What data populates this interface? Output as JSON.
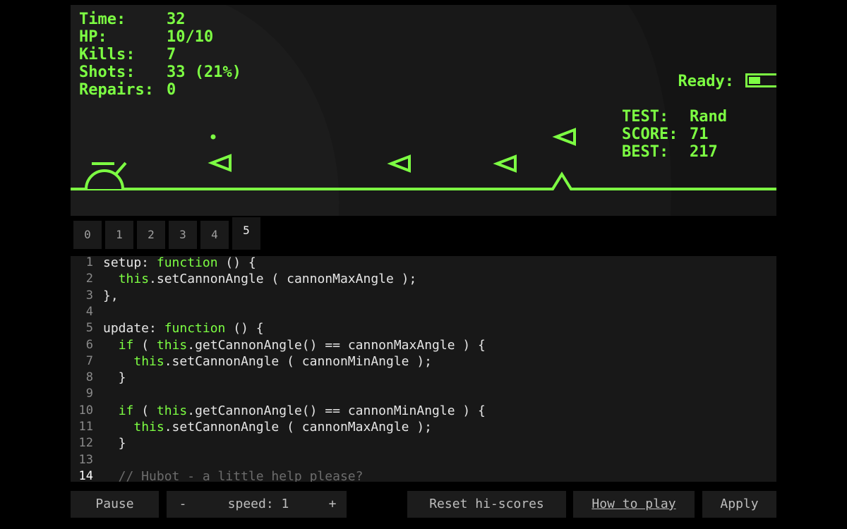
{
  "hud": {
    "left": [
      {
        "label": "Time:",
        "value": "32"
      },
      {
        "label": "HP:",
        "value": "10/10"
      },
      {
        "label": "Kills:",
        "value": "7"
      },
      {
        "label": "Shots:",
        "value": "33 (21%)"
      },
      {
        "label": "Repairs:",
        "value": "0"
      }
    ],
    "ready_label": "Ready:",
    "ready_fraction": 0.15,
    "right": [
      {
        "label": "TEST:",
        "value": "Rand"
      },
      {
        "label": "SCORE:",
        "value": "71"
      },
      {
        "label": "BEST:",
        "value": "217"
      }
    ]
  },
  "colors": {
    "accent": "#7dff43",
    "canvas": "#1c1c1c",
    "editor": "#181818"
  },
  "tabs": [
    "0",
    "1",
    "2",
    "3",
    "4",
    "5"
  ],
  "active_tab": "5",
  "code": [
    {
      "n": "1",
      "segs": [
        [
          "setup: ",
          ""
        ],
        [
          "function",
          "kw"
        ],
        [
          " () {",
          ""
        ]
      ]
    },
    {
      "n": "2",
      "segs": [
        [
          "  ",
          ""
        ],
        [
          "this",
          "kw"
        ],
        [
          ".setCannonAngle ( cannonMaxAngle );",
          ""
        ]
      ]
    },
    {
      "n": "3",
      "segs": [
        [
          "},",
          ""
        ]
      ]
    },
    {
      "n": "4",
      "segs": []
    },
    {
      "n": "5",
      "segs": [
        [
          "update: ",
          ""
        ],
        [
          "function",
          "kw"
        ],
        [
          " () {",
          ""
        ]
      ]
    },
    {
      "n": "6",
      "segs": [
        [
          "  ",
          ""
        ],
        [
          "if",
          "kw"
        ],
        [
          " ( ",
          ""
        ],
        [
          "this",
          "kw"
        ],
        [
          ".getCannonAngle() == cannonMaxAngle ) {",
          ""
        ]
      ]
    },
    {
      "n": "7",
      "segs": [
        [
          "    ",
          ""
        ],
        [
          "this",
          "kw"
        ],
        [
          ".setCannonAngle ( cannonMinAngle );",
          ""
        ]
      ]
    },
    {
      "n": "8",
      "segs": [
        [
          "  }",
          ""
        ]
      ]
    },
    {
      "n": "9",
      "segs": []
    },
    {
      "n": "10",
      "segs": [
        [
          "  ",
          ""
        ],
        [
          "if",
          "kw"
        ],
        [
          " ( ",
          ""
        ],
        [
          "this",
          "kw"
        ],
        [
          ".getCannonAngle() == cannonMinAngle ) {",
          ""
        ]
      ]
    },
    {
      "n": "11",
      "segs": [
        [
          "    ",
          ""
        ],
        [
          "this",
          "kw"
        ],
        [
          ".setCannonAngle ( cannonMaxAngle );",
          ""
        ]
      ]
    },
    {
      "n": "12",
      "segs": [
        [
          "  }",
          ""
        ]
      ]
    },
    {
      "n": "13",
      "segs": []
    },
    {
      "n": "14",
      "segs": [
        [
          "  // Hubot - a little help please?",
          "cm"
        ]
      ]
    }
  ],
  "current_line": "14",
  "controls": {
    "pause": "Pause",
    "speed_minus": "-",
    "speed_label": "speed: 1",
    "speed_plus": "+",
    "reset": "Reset hi-scores",
    "howto": "How to play",
    "apply": "Apply"
  }
}
